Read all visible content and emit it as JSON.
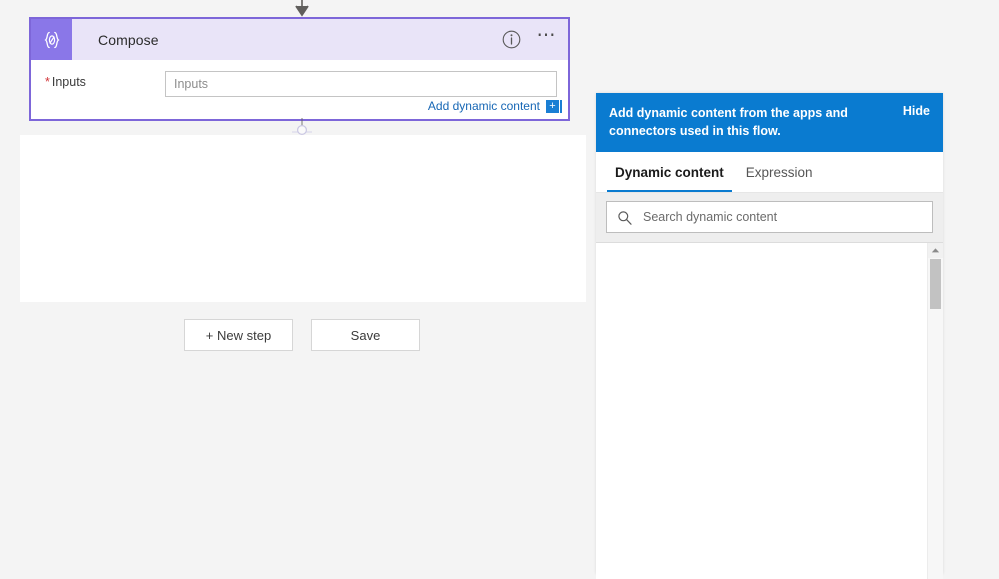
{
  "colors": {
    "canvas_background": "#f4f4f4",
    "card_border_purple": "#7d66d9",
    "card_header_purple": "#e9e4f8",
    "card_icon_tile": "#8a77e8",
    "accent_blue": "#0a7bd0",
    "link_blue": "#1767b5",
    "required_red": "#d13438"
  },
  "card": {
    "icon_name": "compose-braces-icon",
    "title": "Compose",
    "info_icon": "info-circle-icon",
    "more_icon": "ellipsis-menu-icon",
    "field": {
      "label": "Inputs",
      "required_marker": "*",
      "value": "",
      "placeholder": "Inputs"
    },
    "dynamic_content_link": "Add dynamic content",
    "dynamic_content_plus": "+"
  },
  "connectors": {
    "top_arrow_icon": "arrow-down-icon",
    "bottom_node_icon": "insert-node-icon"
  },
  "actions": {
    "new_step_label": "+ New step",
    "save_label": "Save"
  },
  "dynamic_panel": {
    "banner": {
      "message": "Add dynamic content from the apps and connectors used in this flow.",
      "hide_label": "Hide"
    },
    "tabs": [
      {
        "label": "Dynamic content",
        "active": true
      },
      {
        "label": "Expression",
        "active": false
      }
    ],
    "search": {
      "icon": "search-icon",
      "value": "",
      "placeholder": "Search dynamic content"
    },
    "scrollbar": {
      "up_arrow_icon": "chevron-up-icon"
    }
  }
}
